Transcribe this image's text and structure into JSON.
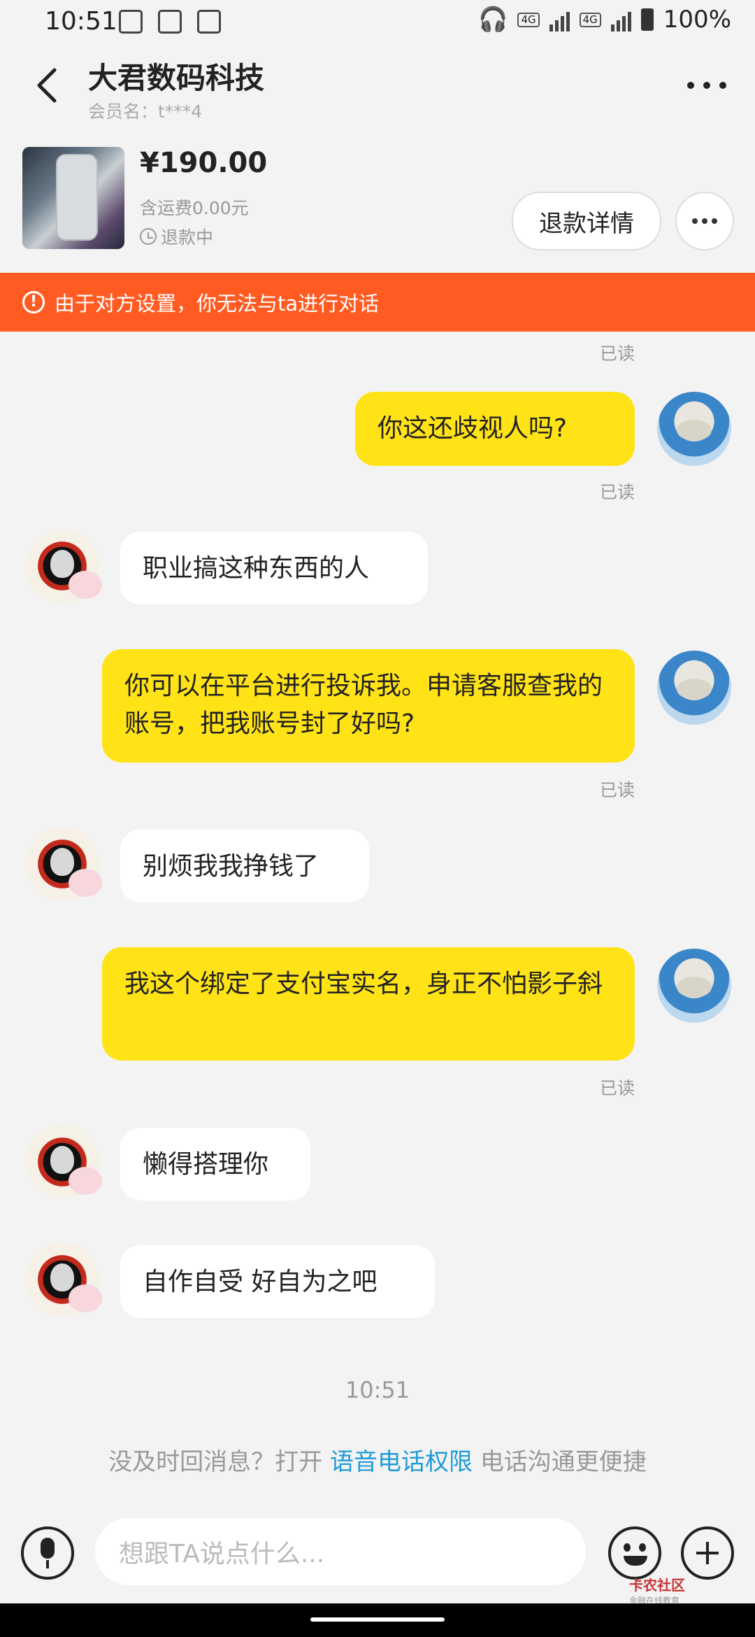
{
  "status_bar": {
    "time": "10:51",
    "battery": "100%",
    "net1": "4G",
    "net2": "4G"
  },
  "header": {
    "title": "大君数码科技",
    "member": "会员名：t***4"
  },
  "order": {
    "price": "¥190.00",
    "shipping": "含运费0.00元",
    "status": "退款中",
    "refund_button": "退款详情"
  },
  "banner": {
    "text": "由于对方设置，你无法与ta进行对话",
    "icon": "warning-icon"
  },
  "messages": [
    {
      "side": "me",
      "text": "你这还歧视人吗?",
      "read": "已读"
    },
    {
      "side": "them",
      "text": "职业搞这种东西的人"
    },
    {
      "side": "me",
      "text": "你可以在平台进行投诉我。申请客服查我的账号，把我账号封了好吗?",
      "read": "已读"
    },
    {
      "side": "them",
      "text": "别烦我我挣钱了"
    },
    {
      "side": "me",
      "text": "我这个绑定了支付宝实名，身正不怕影子斜",
      "read": "已读"
    },
    {
      "side": "them",
      "text": "懒得搭理你"
    },
    {
      "side": "them",
      "text": "自作自受 好自为之吧"
    }
  ],
  "top_read": "已读",
  "timestamp": "10:51",
  "hint": {
    "prefix": "没及时回消息？打开",
    "link": "语音电话权限",
    "suffix": "电话沟通更便捷"
  },
  "input": {
    "placeholder": "想跟TA说点什么..."
  },
  "watermark": {
    "title": "卡农社区",
    "subtitle": "金融在线教育"
  }
}
